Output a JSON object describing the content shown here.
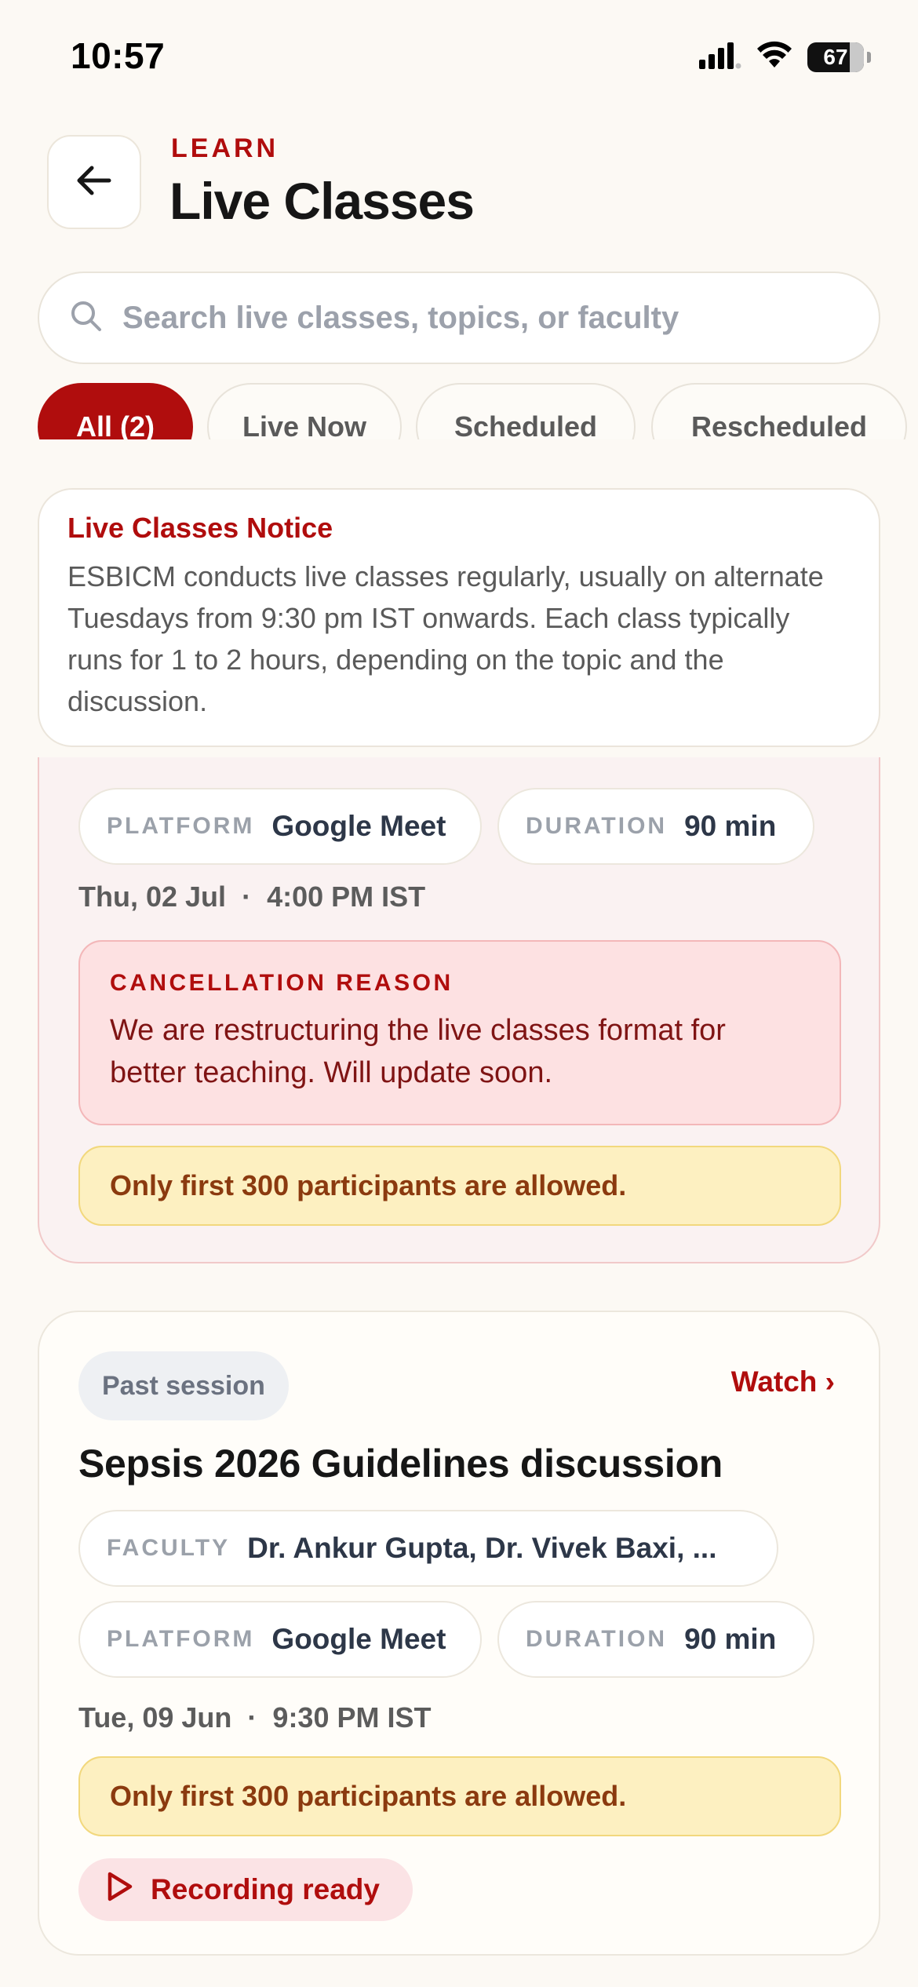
{
  "status_bar": {
    "time": "10:57",
    "battery_level": "67"
  },
  "header": {
    "eyebrow": "LEARN",
    "title": "Live Classes"
  },
  "search": {
    "placeholder": "Search live classes, topics, or faculty"
  },
  "filters": [
    {
      "label": "All (2)",
      "active": true
    },
    {
      "label": "Live Now",
      "active": false
    },
    {
      "label": "Scheduled",
      "active": false
    },
    {
      "label": "Rescheduled",
      "active": false
    }
  ],
  "notice": {
    "title": "Live Classes Notice",
    "body": "ESBICM conducts live classes regularly, usually on alternate Tuesdays from 9:30 pm IST onwards. Each class typically runs for 1 to 2 hours, depending on the topic and the discussion."
  },
  "cancelled_card": {
    "platform_label": "PLATFORM",
    "platform": "Google Meet",
    "duration_label": "DURATION",
    "duration": "90 min",
    "date": "Thu, 02 Jul",
    "time": "4:00 PM IST",
    "cancellation_label": "CANCELLATION REASON",
    "cancellation_reason": "We are restructuring the live classes format for better teaching. Will update soon.",
    "limit_notice": "Only first 300 participants are allowed."
  },
  "past_card": {
    "status": "Past session",
    "action": "Watch ›",
    "title": "Sepsis 2026 Guidelines discussion",
    "faculty_label": "FACULTY",
    "faculty": "Dr. Ankur Gupta, Dr. Vivek Baxi, ...",
    "platform_label": "PLATFORM",
    "platform": "Google Meet",
    "duration_label": "DURATION",
    "duration": "90 min",
    "date": "Tue, 09 Jun",
    "time": "9:30 PM IST",
    "limit_notice": "Only first 300 participants are allowed.",
    "recording": "Recording ready"
  },
  "colors": {
    "accent": "#b00d0d",
    "background": "#fcf9f4",
    "warning_bg": "#fdf0c1",
    "danger_bg": "#fde1e2"
  },
  "icons": [
    "cellular-signal-icon",
    "wifi-icon",
    "battery-icon",
    "back-arrow-icon",
    "search-icon",
    "play-icon"
  ]
}
